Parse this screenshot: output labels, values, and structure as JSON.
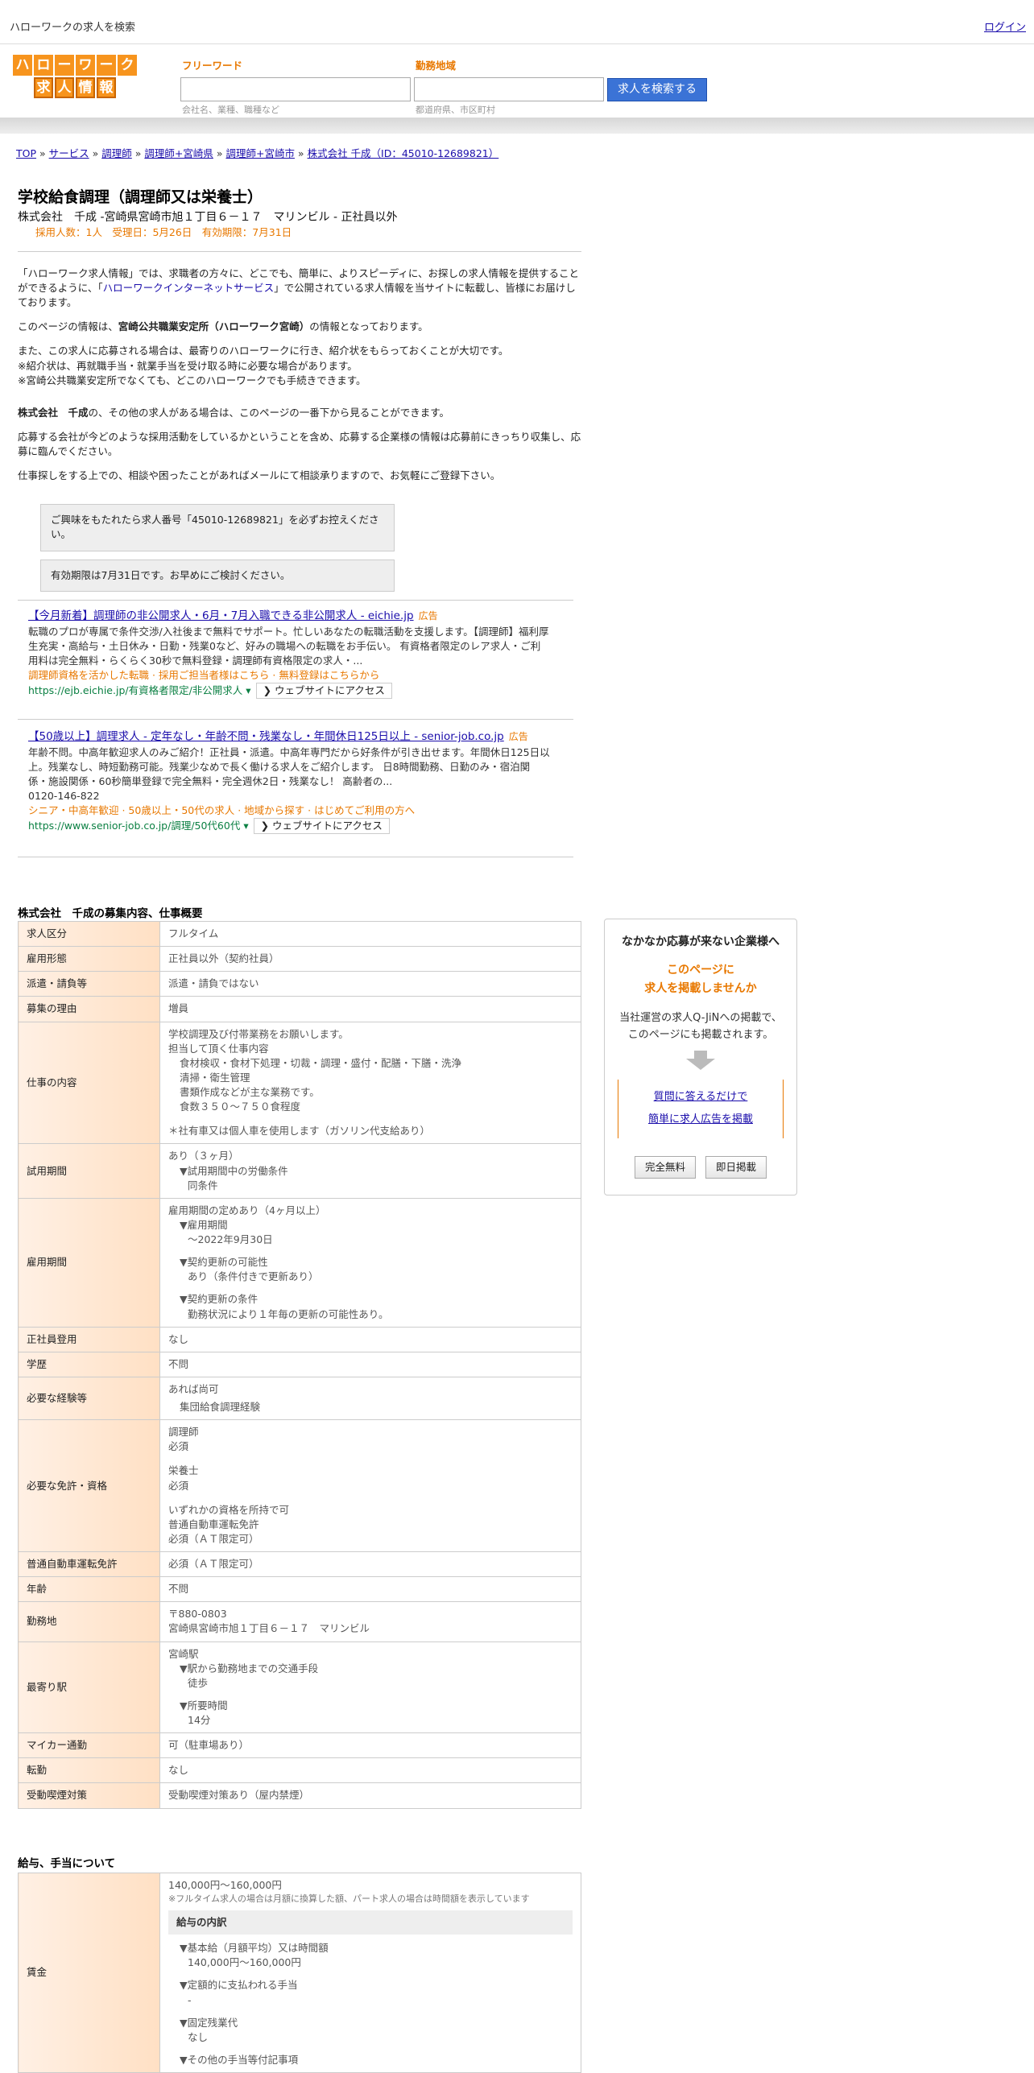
{
  "top": {
    "title": "ハローワークの求人を検索",
    "login": "ログイン"
  },
  "logo": {
    "row1": [
      "ハ",
      "ロ",
      "ー",
      "ワ",
      "ー",
      "ク"
    ],
    "row2": [
      "求",
      "人",
      "情",
      "報"
    ]
  },
  "search": {
    "freeword_label": "フリーワード",
    "freeword_hint": "会社名、業種、職種など",
    "area_label": "勤務地域",
    "area_hint": "都道府県、市区町村",
    "button": "求人を検索する"
  },
  "breadcrumb": [
    "TOP",
    "サービス",
    "調理師",
    "調理師+宮崎県",
    "調理師+宮崎市",
    "株式会社 千成（ID：45010-12689821）"
  ],
  "job": {
    "title": "学校給食調理（調理師又は栄養士）",
    "subline": "株式会社　千成 -宮崎県宮崎市旭１丁目６－１７　マリンビル - 正社員以外",
    "meta": "採用人数：1人　受理日：5月26日　有効期限：7月31日"
  },
  "intro": {
    "p1_a": "「ハローワーク求人情報」では、求職者の方々に、どこでも、簡単に、よりスピーディに、お探しの求人情報を提供することができるように、「",
    "p1_link": "ハローワークインターネットサービス",
    "p1_b": "」で公開されている求人情報を当サイトに転載し、皆様にお届けしております。",
    "p2_a": "このページの情報は、",
    "p2_bold": "宮崎公共職業安定所（ハローワーク宮崎）",
    "p2_b": "の情報となっております。",
    "p3": [
      "また、この求人に応募される場合は、最寄りのハローワークに行き、紹介状をもらっておくことが大切です。",
      "※紹介状は、再就職手当・就業手当を受け取る時に必要な場合があります。",
      "※宮崎公共職業安定所でなくても、どこのハローワークでも手続きできます。"
    ],
    "p4_bold": "株式会社　千成",
    "p4": "の、その他の求人がある場合は、このページの一番下から見ることができます。",
    "p5": "応募する会社が今どのような採用活動をしているかということを含め、応募する企業様の情報は応募前にきっちり収集し、応募に臨んでください。",
    "p6": "仕事探しをする上での、相談や困ったことがあればメールにて相談承りますので、お気軽にご登録下さい。",
    "note1": "ご興味をもたれたら求人番号「45010-12689821」を必ずお控えください。",
    "note2": "有効期限は7月31日です。お早めにご検討ください。"
  },
  "ads": [
    {
      "title": "【今月新着】調理師の非公開求人・6月・7月入職できる非公開求人 - eichie.jp",
      "tag": "広告",
      "desc": "転職のプロが専属で条件交渉/入社後まで無料でサポート。忙しいあなたの転職活動を支援します。【調理師】福利厚生充実・高給与・土日休み・日勤・残業0など、好みの職場への転職をお手伝い。 有資格者限定のレア求人・ご利用料は完全無料・らくらく30秒で無料登録・調理師有資格限定の求人・...",
      "orange": "調理師資格を活かした転職 · 採用ご担当者様はこちら · 無料登録はこちらから",
      "url": "https://ejb.eichie.jp/有資格者限定/非公開求人 ▾",
      "visit": "❯ ウェブサイトにアクセス"
    },
    {
      "title": "【50歳以上】調理求人 - 定年なし・年齢不問・残業なし・年間休日125日以上 - senior-job.co.jp",
      "tag": "広告",
      "desc": "年齢不問。中高年歓迎求人のみご紹介！正社員・派遣。中高年専門だから好条件が引き出せます。年間休日125日以上。残業なし、時短勤務可能。残業少なめで長く働ける求人をご紹介します。 日8時間勤務、日勤のみ・宿泊関係・施設関係・60秒簡単登録で完全無料・完全週休2日・残業なし！ 高齢者の...",
      "phone": "0120-146-822",
      "orange": "シニア・中高年歓迎 · 50歳以上・50代の求人 · 地域から探す · はじめてご利用の方へ",
      "url": "https://www.senior-job.co.jp/調理/50代60代 ▾",
      "visit": "❯ ウェブサイトにアクセス"
    }
  ],
  "details_title": "株式会社　千成の募集内容、仕事概要",
  "details": [
    {
      "k": "求人区分",
      "v": "フルタイム"
    },
    {
      "k": "雇用形態",
      "v": "正社員以外（契約社員）"
    },
    {
      "k": "派遣・請負等",
      "v": "派遣・請負ではない"
    },
    {
      "k": "募集の理由",
      "v": "増員"
    }
  ],
  "work": {
    "k": "仕事の内容",
    "lines": [
      "学校調理及び付帯業務をお願いします。",
      "担当して頂く仕事内容"
    ],
    "sub": [
      "食材検収・食材下処理・切裁・調理・盛付・配膳・下膳・洗浄",
      "清掃・衛生管理",
      "書類作成などが主な業務です。",
      "食数３５０～７５０食程度"
    ],
    "note": "＊社有車又は個人車を使用します（ガソリン代支給あり）"
  },
  "trial": {
    "k": "試用期間",
    "v": "あり（３ヶ月）",
    "s1": "▼試用期間中の労働条件",
    "s2": "同条件"
  },
  "period": {
    "k": "雇用期間",
    "v": "雇用期間の定めあり（4ヶ月以上）",
    "a1": "▼雇用期間",
    "a2": "〜2022年9月30日",
    "b1": "▼契約更新の可能性",
    "b2": "あり（条件付きで更新あり）",
    "c1": "▼契約更新の条件",
    "c2": "勤務状況により１年毎の更新の可能性あり。"
  },
  "details2": [
    {
      "k": "正社員登用",
      "v": "なし"
    },
    {
      "k": "学歴",
      "v": "不問"
    }
  ],
  "exp": {
    "k": "必要な経験等",
    "v": "あれば尚可",
    "s": "集団給食調理経験"
  },
  "lic": {
    "k": "必要な免許・資格",
    "lines": [
      "調理師",
      "必須",
      "",
      "栄養士",
      "必須",
      "",
      "いずれかの資格を所持で可",
      "普通自動車運転免許",
      "必須（ＡＴ限定可）"
    ]
  },
  "details3": [
    {
      "k": "普通自動車運転免許",
      "v": "必須（ＡＴ限定可）"
    },
    {
      "k": "年齢",
      "v": "不問"
    }
  ],
  "place": {
    "k": "勤務地",
    "v1": "〒880-0803",
    "v2": "宮崎県宮崎市旭１丁目６－１７　マリンビル"
  },
  "station": {
    "k": "最寄り駅",
    "v": "宮崎駅",
    "a1": "▼駅から勤務地までの交通手段",
    "a2": "徒歩",
    "b1": "▼所要時間",
    "b2": "14分"
  },
  "details4": [
    {
      "k": "マイカー通勤",
      "v": "可（駐車場あり）"
    },
    {
      "k": "転勤",
      "v": "なし"
    },
    {
      "k": "受動喫煙対策",
      "v": "受動喫煙対策あり（屋内禁煙）"
    }
  ],
  "salary_title": "給与、手当について",
  "salary": {
    "k": "賃金",
    "v": "140,000円〜160,000円",
    "note": "※フルタイム求人の場合は月額に換算した額、パート求人の場合は時間額を表示しています",
    "box": "給与の内訳",
    "a1": "▼基本給（月額平均）又は時間額",
    "a2": "140,000円〜160,000円",
    "b1": "▼定額的に支払われる手当",
    "b2": "-",
    "c1": "▼固定残業代",
    "c2": "なし",
    "d1": "▼その他の手当等付記事項"
  },
  "side": {
    "heading": "なかなか応募が来ない企業様へ",
    "orange1": "このページに",
    "orange2": "求人を掲載しませんか",
    "body1": "当社運営の求人Q-JiNへの掲載で、",
    "body2": "このページにも掲載されます。",
    "link1": "質問に答えるだけで",
    "link2": "簡単に求人広告を掲載",
    "btn1": "完全無料",
    "btn2": "即日掲載"
  }
}
